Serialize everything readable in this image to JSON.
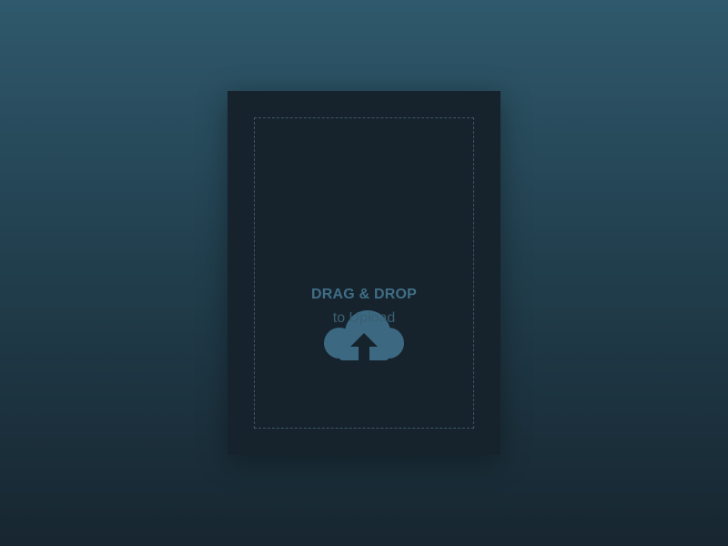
{
  "upload": {
    "title": "DRAG & DROP",
    "subtitle": "to Upload",
    "icon": "cloud-upload-icon"
  },
  "colors": {
    "accent": "#3f6e86",
    "card": "#17232c",
    "dashed_border": "#3f5766"
  }
}
